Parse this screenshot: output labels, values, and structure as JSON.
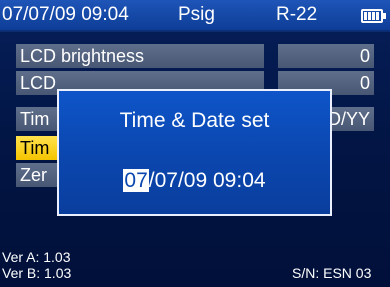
{
  "status_bar": {
    "datetime": "07/07/09 09:04",
    "unit": "Psig",
    "refrigerant": "R-22"
  },
  "menu": {
    "items": [
      {
        "label": "LCD brightness",
        "value": "0"
      },
      {
        "label": "LCD",
        "value": "0"
      },
      {
        "label": "Tim",
        "value": "D/YY"
      },
      {
        "label": "Tim",
        "value": ""
      },
      {
        "label": "Zer",
        "value": ""
      }
    ]
  },
  "dialog": {
    "title": "Time & Date set",
    "value_cursor": "07",
    "value_rest": "/07/09 09:04"
  },
  "footer": {
    "ver_a": "Ver A:  1.03",
    "ver_b": "Ver B:  1.03",
    "serial": "S/N: ESN 03"
  },
  "icons": {
    "battery": "battery-icon"
  }
}
